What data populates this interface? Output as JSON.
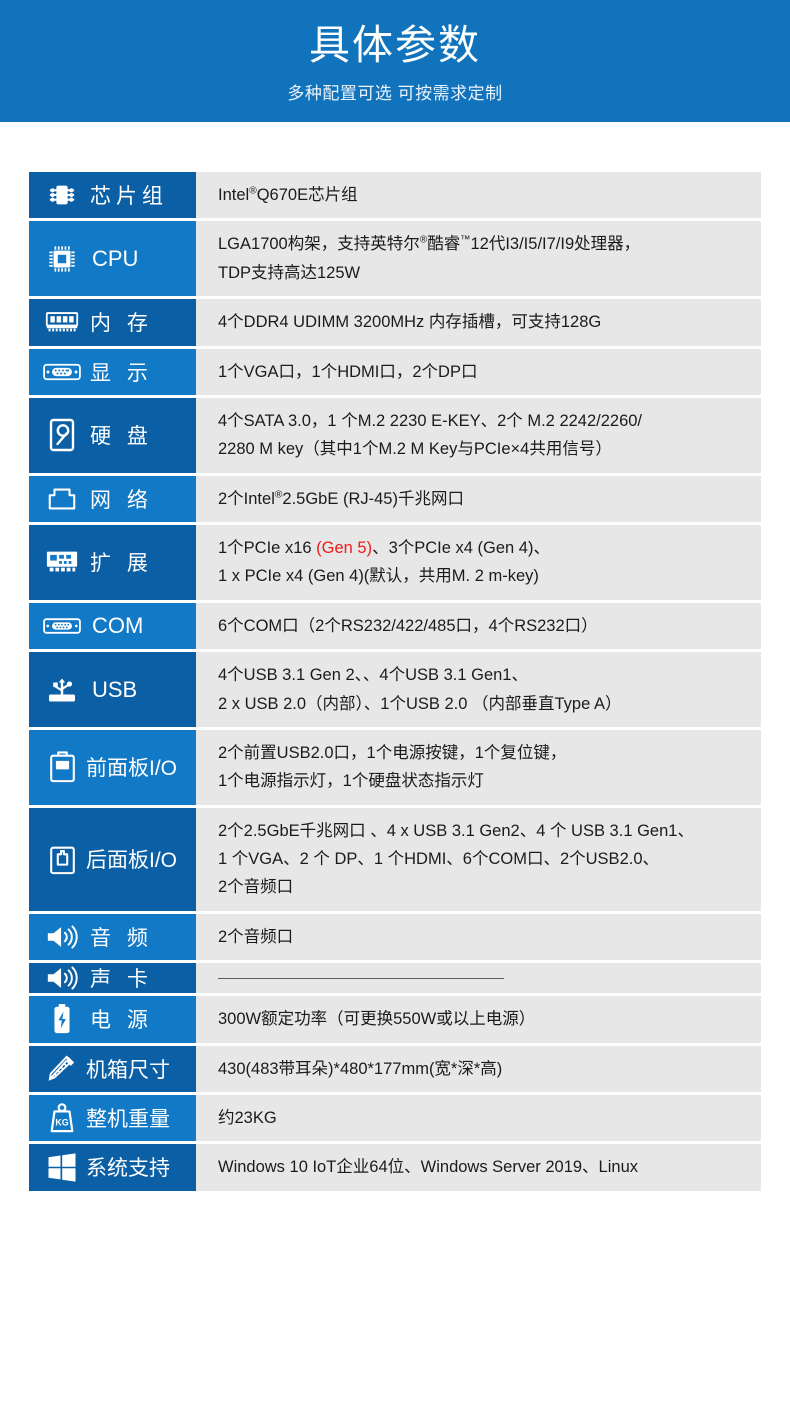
{
  "banner": {
    "title": "具体参数",
    "subtitle": "多种配置可选 可按需求定制"
  },
  "colors": {
    "banner_blue": "#1273bd",
    "label_dark": "#0b5fa5",
    "label_light": "#1279c6",
    "value_gray": "#e7e7e7",
    "highlight_red": "#ee1c1c"
  },
  "rows": [
    {
      "icon": "chipset-icon",
      "label": "芯片组",
      "label_style": "spaced",
      "lines": [
        "Intel®Q670E芯片组"
      ]
    },
    {
      "icon": "cpu-icon",
      "label": "CPU",
      "label_style": "latin",
      "lines": [
        "LGA1700构架，支持英特尔®酷睿™12代I3/I5/I7/I9处理器，",
        "TDP支持高达125W"
      ]
    },
    {
      "icon": "memory-icon",
      "label": "内 存",
      "label_style": "spaced",
      "lines": [
        "4个DDR4 UDIMM 3200MHz 内存插槽，可支持128G"
      ]
    },
    {
      "icon": "display-icon",
      "label": "显 示",
      "label_style": "spaced",
      "lines": [
        "1个VGA口，1个HDMI口，2个DP口"
      ]
    },
    {
      "icon": "harddisk-icon",
      "label": "硬 盘",
      "label_style": "spaced",
      "lines": [
        " 4个SATA 3.0，1 个M.2 2230 E-KEY、2个 M.2 2242/2260/",
        " 2280 M key（其中1个M.2 M Key与PCIe×4共用信号）"
      ]
    },
    {
      "icon": "network-icon",
      "label": "网 络",
      "label_style": "spaced",
      "lines": [
        "2个Intel®2.5GbE (RJ-45)千兆网口"
      ]
    },
    {
      "icon": "expansion-icon",
      "label": "扩 展",
      "label_style": "spaced",
      "lines": [
        "1个PCIe x16 (Gen 5)、3个PCIe x4 (Gen 4)、",
        "1 x PCIe x4 (Gen 4)(默认，共用M. 2 m-key)"
      ],
      "highlight": "(Gen 5)"
    },
    {
      "icon": "com-port-icon",
      "label": "COM",
      "label_style": "latin",
      "lines": [
        "6个COM口（2个RS232/422/485口，4个RS232口）"
      ]
    },
    {
      "icon": "usb-icon",
      "label": "USB",
      "label_style": "latin",
      "lines": [
        "4个USB 3.1 Gen 2、、4个USB 3.1 Gen1、",
        "2 x USB 2.0（内部）、1个USB 2.0 （内部垂直Type A）"
      ]
    },
    {
      "icon": "front-panel-icon",
      "label": "前面板I/O",
      "label_style": "tight",
      "lines": [
        "2个前置USB2.0口，1个电源按键，1个复位键，",
        "1个电源指示灯，1个硬盘状态指示灯"
      ]
    },
    {
      "icon": "rear-panel-icon",
      "label": "后面板I/O",
      "label_style": "tight",
      "lines": [
        "2个2.5GbE千兆网口 、4 x USB 3.1 Gen2、4 个 USB 3.1 Gen1、",
        "1 个VGA、2 个 DP、1 个HDMI、6个COM口、2个USB2.0、",
        "2个音频口"
      ]
    },
    {
      "icon": "audio-icon",
      "label": "音 频",
      "label_style": "spaced",
      "lines": [
        "2个音频口"
      ]
    },
    {
      "icon": "soundcard-icon",
      "label": "声 卡",
      "label_style": "spaced",
      "lines": [],
      "rule": true
    },
    {
      "icon": "power-icon",
      "label": "电 源",
      "label_style": "spaced",
      "lines": [
        "300W额定功率（可更换550W或以上电源）"
      ]
    },
    {
      "icon": "dimensions-icon",
      "label": "机箱尺寸",
      "label_style": "tight",
      "lines": [
        "430(483带耳朵)*480*177mm(宽*深*高)"
      ]
    },
    {
      "icon": "weight-icon",
      "label": "整机重量",
      "label_style": "tight",
      "lines": [
        "约23KG"
      ]
    },
    {
      "icon": "windows-icon",
      "label": "系统支持",
      "label_style": "tight",
      "lines": [
        "Windows 10 IoT企业64位、Windows Server 2019、Linux"
      ]
    }
  ]
}
